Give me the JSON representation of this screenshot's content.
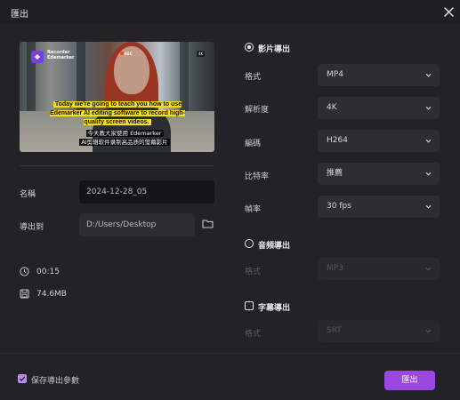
{
  "window": {
    "title": "匯出",
    "close_icon": "close-icon"
  },
  "preview": {
    "logo_text": "Edemarker",
    "logo_subtext": "Recorder",
    "rec_badge": "REC",
    "resolution_badge": "4K",
    "caption_en": "Today we're going to teach you how to use Edemarker AI editing software to record high-quality screen videos.",
    "caption_cn_line1": "今天教大家使用 Edemarker",
    "caption_cn_line2": "AI剪辑软件录制高品质的萤幕影片"
  },
  "left_form": {
    "name_label": "名稱",
    "name_value": "2024-12-28_05",
    "export_to_label": "導出到",
    "export_to_value": "D:/Users/Desktop",
    "folder_icon": "folder-icon"
  },
  "info": {
    "duration": "00:15",
    "duration_icon": "clock-icon",
    "size": "74.6MB",
    "size_icon": "save-icon"
  },
  "video_export": {
    "title": "影片導出",
    "selected": true,
    "fields": [
      {
        "label": "格式",
        "value": "MP4"
      },
      {
        "label": "解析度",
        "value": "4K"
      },
      {
        "label": "編碼",
        "value": "H264"
      },
      {
        "label": "比特率",
        "value": "推薦"
      },
      {
        "label": "幀率",
        "value": "30  fps"
      }
    ]
  },
  "audio_export": {
    "title": "音頻導出",
    "selected": false,
    "format_label": "格式",
    "format_value": "MP3"
  },
  "subtitle_export": {
    "title": "字幕導出",
    "checked": false,
    "format_label": "格式",
    "format_value": "SRT"
  },
  "footer": {
    "save_params_label": "保存導出參數",
    "save_params_checked": true,
    "export_button": "匯出"
  },
  "colors": {
    "accent": "#9b48e0",
    "background": "#222227",
    "field": "#2d2d33"
  }
}
